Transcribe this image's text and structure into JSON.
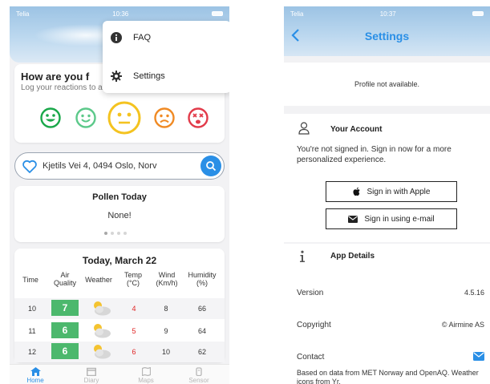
{
  "left_screen": {
    "status": {
      "carrier": "Telia",
      "time": "10:36"
    },
    "menu": {
      "items": [
        {
          "label": "FAQ",
          "icon": "info-circle-icon"
        },
        {
          "label": "Settings",
          "icon": "gear-icon"
        }
      ]
    },
    "feel": {
      "title": "How are you f",
      "subtitle": "Log your reactions to air pollution and pollen.",
      "faces": [
        {
          "icon": "very-happy-face-icon",
          "color": "#1aa84a"
        },
        {
          "icon": "happy-face-icon",
          "color": "#5cc98a"
        },
        {
          "icon": "neutral-face-icon",
          "color": "#f4c320"
        },
        {
          "icon": "sad-face-icon",
          "color": "#f08a24"
        },
        {
          "icon": "very-sad-face-icon",
          "color": "#e23b4a"
        }
      ]
    },
    "search": {
      "value": "Kjetils Vei 4, 0494 Oslo, Norv"
    },
    "pollen": {
      "title": "Pollen Today",
      "value": "None!"
    },
    "weather": {
      "title": "Today, March 22",
      "headers": [
        "Time",
        "Air Quality",
        "Weather",
        "Temp (°C)",
        "Wind (Km/h)",
        "Humidity (%)"
      ],
      "rows": [
        {
          "time": "10",
          "aq": "7",
          "temp": "4",
          "wind": "8",
          "humidity": "66"
        },
        {
          "time": "11",
          "aq": "6",
          "temp": "5",
          "wind": "9",
          "humidity": "64"
        },
        {
          "time": "12",
          "aq": "6",
          "temp": "6",
          "wind": "10",
          "humidity": "62"
        }
      ]
    },
    "tabs": [
      {
        "label": "Home",
        "icon": "home-icon",
        "active": true
      },
      {
        "label": "Diary",
        "icon": "calendar-icon",
        "active": false
      },
      {
        "label": "Maps",
        "icon": "map-icon",
        "active": false
      },
      {
        "label": "Sensor",
        "icon": "sensor-icon",
        "active": false
      }
    ],
    "colors": {
      "accent": "#2a8fe6",
      "aq_good": "#4cb86d",
      "temp": "#e02424"
    }
  },
  "right_screen": {
    "status": {
      "carrier": "Telia",
      "time": "10:37"
    },
    "nav": {
      "title": "Settings"
    },
    "profile": {
      "text": "Profile not available."
    },
    "account": {
      "title": "Your Account",
      "description": "You're not signed in. Sign in now for a more personalized experience.",
      "apple_button": "Sign in with Apple",
      "email_button": "Sign in using e-mail"
    },
    "details": {
      "title": "App Details",
      "version_label": "Version",
      "version_value": "4.5.16",
      "copyright_label": "Copyright",
      "copyright_value": "© Airmine AS",
      "contact_label": "Contact",
      "footer": "Based on data from MET Norway and OpenAQ. Weather icons from Yr."
    }
  }
}
